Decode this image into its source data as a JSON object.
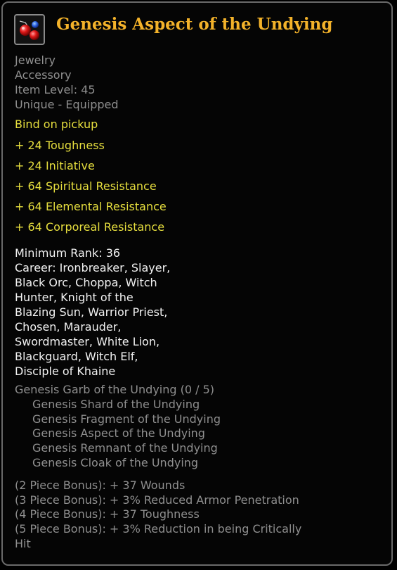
{
  "item": {
    "title": "Genesis Aspect of the Undying",
    "icon": "red-gems-icon",
    "type": "Jewelry",
    "slot": "Accessory",
    "item_level": "Item Level: 45",
    "rarity": "Unique - Equipped",
    "bind": "Bind on pickup"
  },
  "stats": [
    "+ 24 Toughness",
    "+ 24 Initiative",
    "+ 64 Spiritual Resistance",
    "+ 64 Elemental Resistance",
    "+ 64 Corporeal Resistance"
  ],
  "requirements": {
    "min_rank": "Minimum Rank: 36",
    "career": "Career: Ironbreaker, Slayer,\nBlack Orc, Choppa, Witch\nHunter, Knight of the\nBlazing Sun, Warrior Priest,\nChosen, Marauder,\nSwordmaster, White Lion,\nBlackguard, Witch Elf,\nDisciple of Khaine"
  },
  "set": {
    "name": "Genesis Garb of the Undying (0 / 5)",
    "pieces": [
      "Genesis Shard of the Undying",
      "Genesis Fragment of the Undying",
      "Genesis Aspect of the Undying",
      "Genesis Remnant of the Undying",
      "Genesis Cloak of the Undying"
    ],
    "bonuses": [
      "(2 Piece Bonus): + 37 Wounds",
      "(3 Piece Bonus): + 3% Reduced Armor Penetration",
      "(4 Piece Bonus): + 37 Toughness",
      "(5 Piece Bonus): + 3% Reduction in being Critically\nHit"
    ]
  },
  "colors": {
    "title": "#f3b22a",
    "stat": "#e7df3e",
    "muted": "#8f8f8f",
    "body": "#f2f2f2",
    "border": "#6a6a6a"
  }
}
